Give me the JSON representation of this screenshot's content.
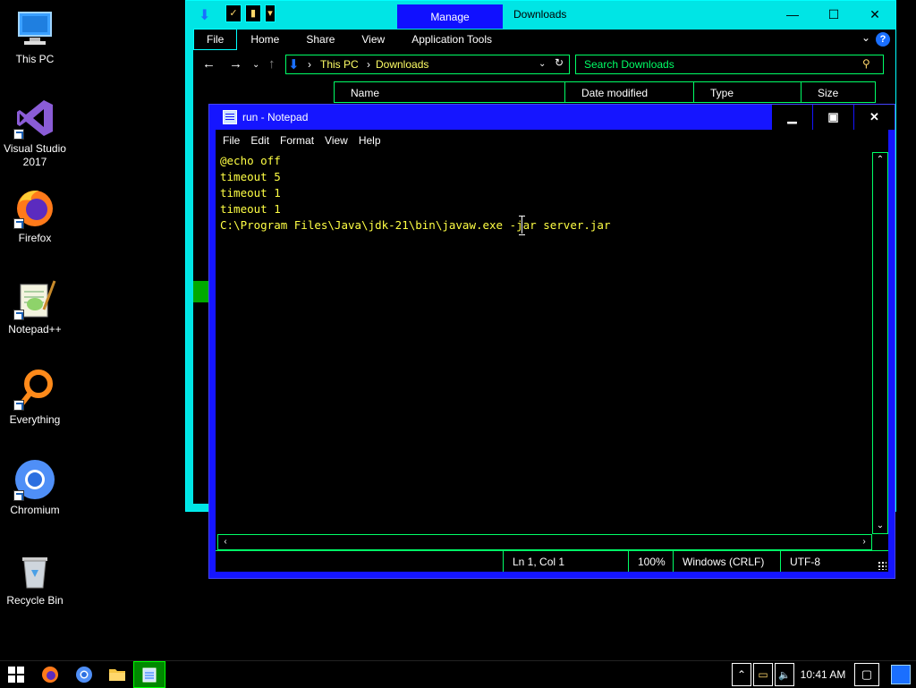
{
  "desktop": {
    "icons": [
      {
        "label": "This PC"
      },
      {
        "label": "Visual Studio 2017"
      },
      {
        "label": "Firefox"
      },
      {
        "label": "Notepad++"
      },
      {
        "label": "Everything"
      },
      {
        "label": "Chromium"
      },
      {
        "label": "Recycle Bin"
      }
    ]
  },
  "explorer": {
    "context_tab": "Manage",
    "title": "Downloads",
    "ribbon_tabs": [
      "File",
      "Home",
      "Share",
      "View",
      "Application Tools"
    ],
    "address": {
      "root": "This PC",
      "folder": "Downloads"
    },
    "search_placeholder": "Search Downloads",
    "columns": [
      "Name",
      "Date modified",
      "Type",
      "Size"
    ]
  },
  "notepad": {
    "title": "run - Notepad",
    "menu": [
      "File",
      "Edit",
      "Format",
      "View",
      "Help"
    ],
    "content": "@echo off\ntimeout 5\ntimeout 1\ntimeout 1\nC:\\Program Files\\Java\\jdk-21\\bin\\javaw.exe -jar server.jar",
    "status": {
      "position": "Ln 1, Col 1",
      "zoom": "100%",
      "line_endings": "Windows (CRLF)",
      "encoding": "UTF-8"
    }
  },
  "taskbar": {
    "apps": [
      "start",
      "firefox",
      "chromium",
      "file-explorer",
      "notepad"
    ],
    "time": "10:41 AM"
  },
  "colors": {
    "accent_cyan": "#00e5e5",
    "notepad_frame": "#1515ff",
    "text_yellow": "#ffff44",
    "border_green": "#00ff66"
  }
}
